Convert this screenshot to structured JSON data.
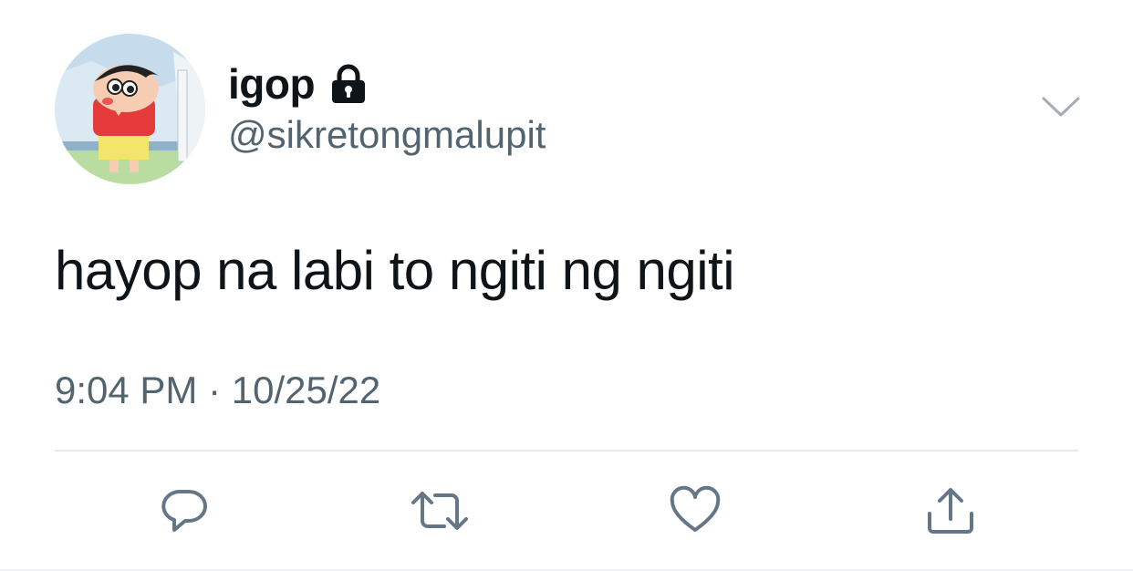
{
  "user": {
    "display_name": "igop",
    "handle": "@sikretongmalupit",
    "avatar": "cartoon-character-avatar",
    "protected_icon": "lock-icon"
  },
  "tweet": {
    "text": "hayop na labi to ngiti ng ngiti",
    "timestamp": "9:04 PM · 10/25/22"
  },
  "menu": {
    "icon": "chevron-down-icon"
  },
  "actions": [
    {
      "name": "reply",
      "icon": "reply-icon"
    },
    {
      "name": "retweet",
      "icon": "retweet-icon"
    },
    {
      "name": "like",
      "icon": "heart-icon"
    },
    {
      "name": "share",
      "icon": "share-icon"
    }
  ],
  "colors": {
    "text_primary": "#0f1419",
    "text_secondary": "#536471",
    "icon_gray": "#657786",
    "divider": "#e6e9ec"
  }
}
